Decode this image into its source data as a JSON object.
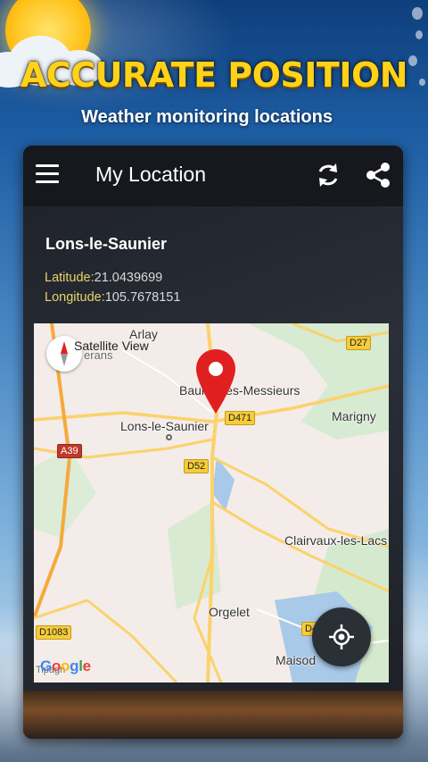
{
  "promo": {
    "headline": "ACCURATE POSITION",
    "subheadline": "Weather monitoring locations"
  },
  "appbar": {
    "title": "My Location",
    "icons": [
      "menu-icon",
      "refresh-icon",
      "share-icon"
    ]
  },
  "location": {
    "name": "Lons-le-Saunier",
    "latitude_label": "Latitude:",
    "latitude_value": "21.0439699",
    "longitude_label": "Longitude:",
    "longitude_value": "105.7678151"
  },
  "map": {
    "view_toggle": "Satellite View",
    "labels": {
      "arlay": "Arlay",
      "baume": "Baume-les-Messieurs",
      "marigny": "Marigny",
      "lons": "Lons-le-Saunier",
      "clairvaux": "Clairvaux-les-Lacs",
      "orgelet": "Orgelet",
      "maisod": "Maisod",
      "fragment": "erans",
      "fragment2": "Tipagn"
    },
    "routes": {
      "d27": "D27",
      "d471": "D471",
      "a39": "A39",
      "d52": "D52",
      "d1083": "D1083",
      "d4": "D4"
    },
    "attribution": "Google"
  },
  "colors": {
    "accent_yellow": "#ffd21a",
    "pin_red": "#e02020",
    "coord_label": "#e9d46a"
  }
}
